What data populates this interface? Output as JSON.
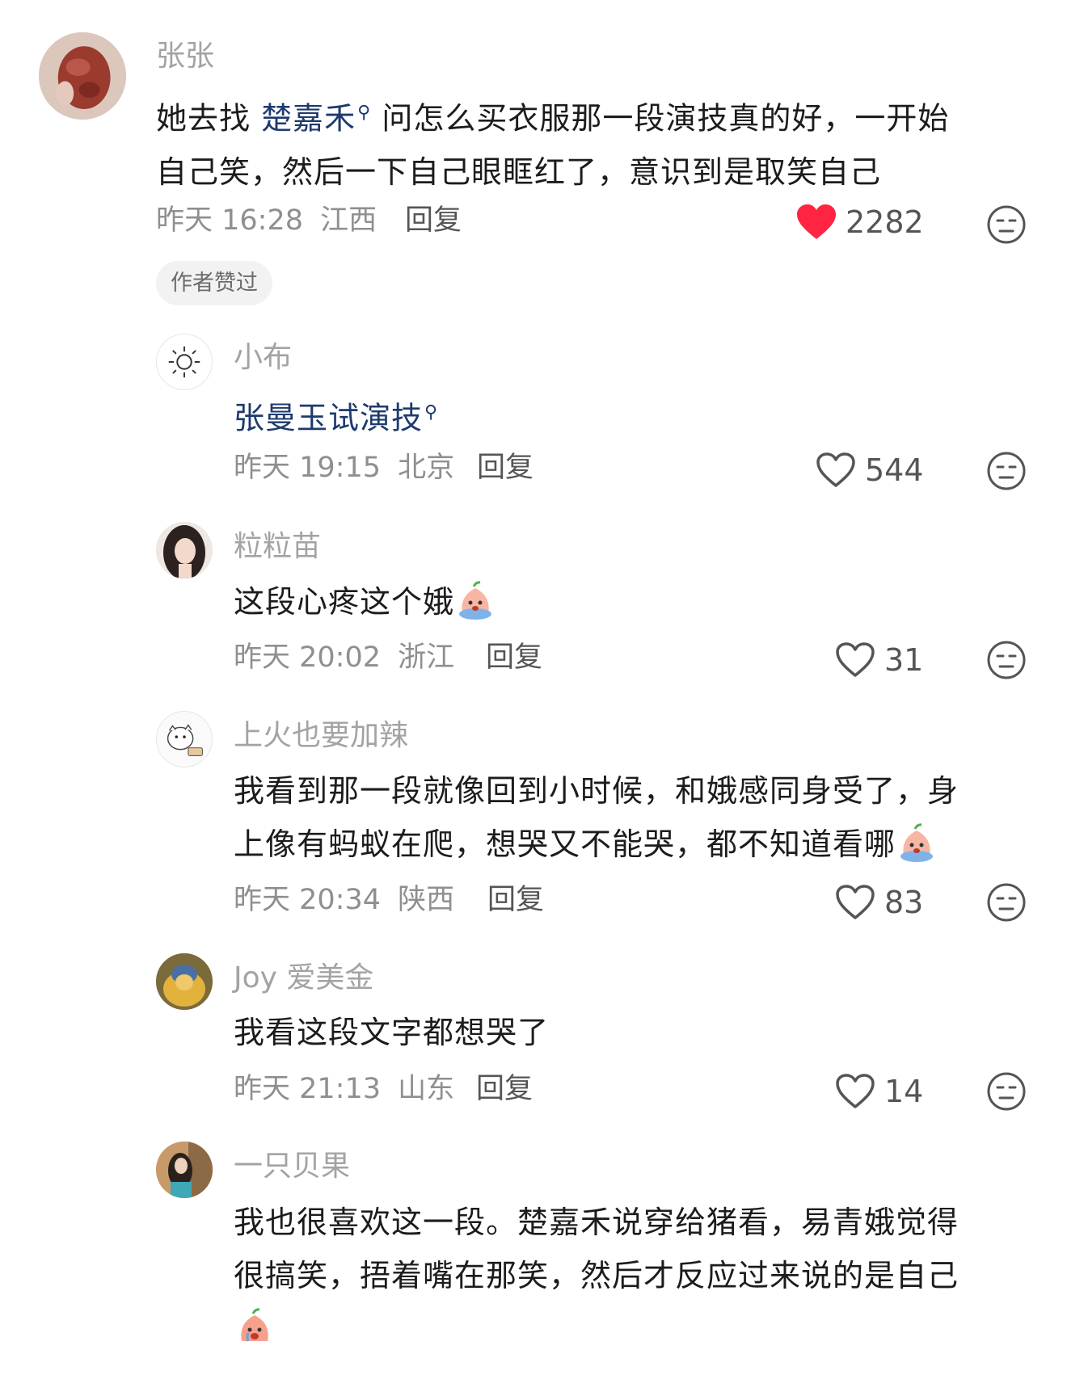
{
  "colors": {
    "liked_heart": "#ff2442",
    "mention": "#1e3a6e",
    "muted_text": "#a3a3a3"
  },
  "comments": [
    {
      "author": "张张",
      "text_before": "她去找 ",
      "mention": "楚嘉禾",
      "text_line1_rest": " 问怎么买衣服那一段演技真的好，一开始",
      "text_line2": "自己笑，然后一下自己眼眶红了，意识到是取笑自己",
      "time": "昨天 16:28",
      "location": "江西",
      "reply_label": "回复",
      "likes": "2282",
      "liked": true,
      "badge": "作者赞过",
      "avatar_icon": "meat-avatar"
    },
    {
      "author": "小布",
      "mention": "张曼玉试演技",
      "time": "昨天 19:15",
      "location": "北京",
      "reply_label": "回复",
      "likes": "544",
      "liked": false,
      "avatar_icon": "sun-avatar"
    },
    {
      "author": "粒粒苗",
      "text": "这段心疼这个娥",
      "emoji": "crying-peach-emoji",
      "time": "昨天 20:02",
      "location": "浙江",
      "reply_label": "回复",
      "likes": "31",
      "liked": false,
      "avatar_icon": "girl-avatar"
    },
    {
      "author": "上火也要加辣",
      "text_line1": "我看到那一段就像回到小时候，和娥感同身受了，身",
      "text_line2": "上像有蚂蚁在爬，想哭又不能哭，都不知道看哪",
      "emoji": "crying-peach-emoji",
      "time": "昨天 20:34",
      "location": "陕西",
      "reply_label": "回复",
      "likes": "83",
      "liked": false,
      "avatar_icon": "cartoon-dog-avatar"
    },
    {
      "author": "Joy 爱美金",
      "text": "我看这段文字都想哭了",
      "time": "昨天 21:13",
      "location": "山东",
      "reply_label": "回复",
      "likes": "14",
      "liked": false,
      "avatar_icon": "gold-figure-avatar"
    },
    {
      "author": "一只贝果",
      "text_line1": "我也很喜欢这一段。楚嘉禾说穿给猪看，易青娥觉得",
      "text_line2": "很搞笑，捂着嘴在那笑，然后才反应过来说的是自己",
      "emoji": "crying-peach-emoji",
      "avatar_icon": "woman-avatar"
    }
  ]
}
